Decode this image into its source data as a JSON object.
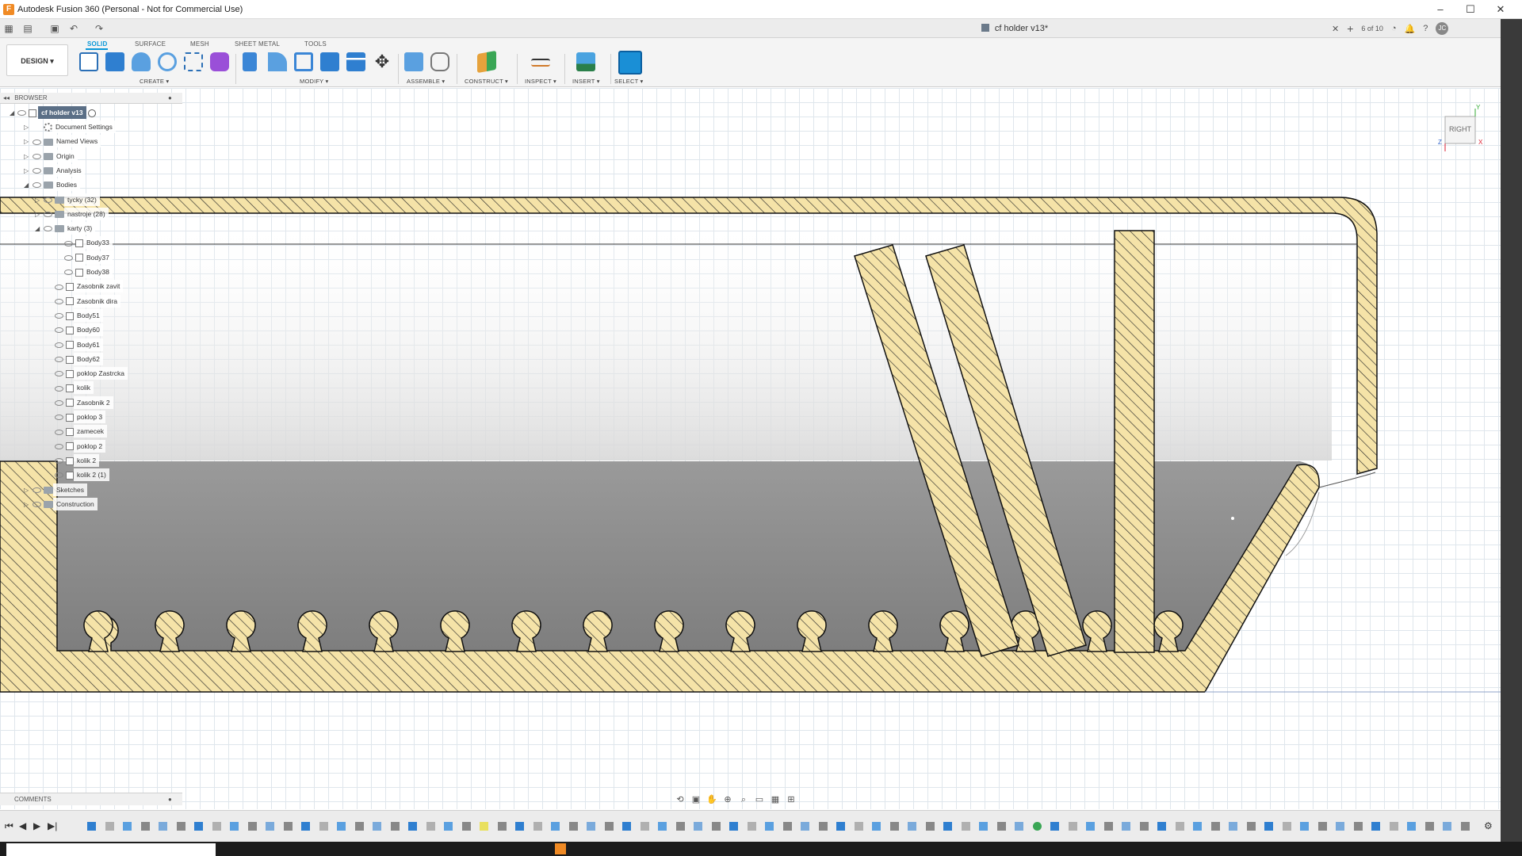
{
  "window": {
    "title": "Autodesk Fusion 360 (Personal - Not for Commercial Use)",
    "minimize": "–",
    "maximize": "☐",
    "close": "✕"
  },
  "document": {
    "tab_title": "cf holder v13*",
    "version_badge": "6 of 10"
  },
  "ribbon": {
    "workspace": "DESIGN ▾",
    "tabs": [
      "SOLID",
      "SURFACE",
      "MESH",
      "SHEET METAL",
      "TOOLS"
    ],
    "groups": [
      "CREATE ▾",
      "MODIFY ▾",
      "ASSEMBLE ▾",
      "CONSTRUCT ▾",
      "INSPECT ▾",
      "INSERT ▾",
      "SELECT ▾"
    ]
  },
  "browser": {
    "header": "BROWSER",
    "root": "cf holder v13",
    "items": [
      {
        "label": "Document Settings",
        "icon": "gear-icon"
      },
      {
        "label": "Named Views",
        "icon": "folder-icon"
      },
      {
        "label": "Origin",
        "icon": "folder-icon"
      },
      {
        "label": "Analysis",
        "icon": "folder-icon"
      },
      {
        "label": "Bodies",
        "icon": "folder-icon"
      },
      {
        "label": "tycky (32)",
        "icon": "folder-icon"
      },
      {
        "label": "nastroje (28)",
        "icon": "folder-icon"
      },
      {
        "label": "karty (3)",
        "icon": "folder-icon"
      },
      {
        "label": "Body33",
        "icon": "body-icon"
      },
      {
        "label": "Body37",
        "icon": "body-icon"
      },
      {
        "label": "Body38",
        "icon": "body-icon"
      },
      {
        "label": "Zasobnik zavit",
        "icon": "body-icon"
      },
      {
        "label": "Zasobnik dira",
        "icon": "body-icon"
      },
      {
        "label": "Body51",
        "icon": "body-icon"
      },
      {
        "label": "Body60",
        "icon": "body-icon"
      },
      {
        "label": "Body61",
        "icon": "body-icon"
      },
      {
        "label": "Body62",
        "icon": "body-icon"
      },
      {
        "label": "poklop Zastrcka",
        "icon": "body-icon"
      },
      {
        "label": "kolik",
        "icon": "body-icon"
      },
      {
        "label": "Zasobnik 2",
        "icon": "body-icon"
      },
      {
        "label": "poklop 3",
        "icon": "body-icon"
      },
      {
        "label": "zamecek",
        "icon": "body-icon"
      },
      {
        "label": "poklop 2",
        "icon": "body-icon"
      },
      {
        "label": "kolik 2",
        "icon": "body-icon"
      },
      {
        "label": "kolik 2 (1)",
        "icon": "body-icon"
      },
      {
        "label": "Sketches",
        "icon": "folder-icon"
      },
      {
        "label": "Construction",
        "icon": "folder-icon"
      }
    ]
  },
  "viewcube": {
    "face": "RIGHT",
    "axis_y": "Y",
    "axis_z": "Z",
    "axis_x": "X"
  },
  "comments": {
    "label": "COMMENTS"
  },
  "colors": {
    "accent": "#0696d7",
    "hatch_fill": "#f5e3a8",
    "section_gray": "#8a8a8a"
  }
}
